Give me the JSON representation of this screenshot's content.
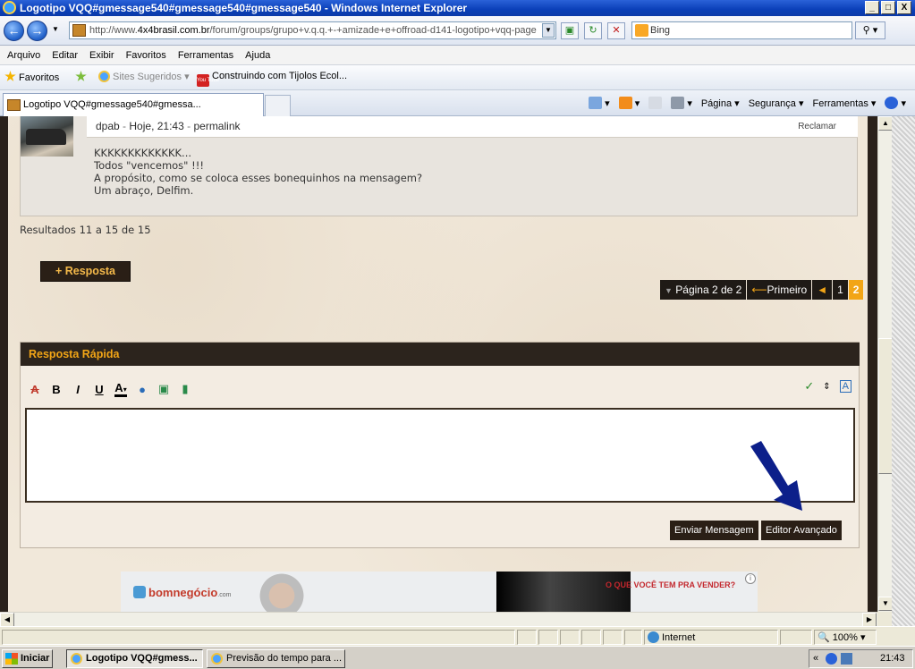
{
  "window": {
    "title": "Logotipo VQQ#gmessage540#gmessage540#gmessage540 - Windows Internet Explorer",
    "controls": [
      "_",
      "□",
      "X"
    ]
  },
  "address": {
    "url_prefix": "http://www.",
    "url_domain": "4x4brasil.com.br",
    "url_path": "/forum/groups/grupo+v.q.q.+-+amizade+e+offroad-d141-logotipo+vqq-page",
    "search_placeholder": "Bing"
  },
  "menu": [
    "Arquivo",
    "Editar",
    "Exibir",
    "Favoritos",
    "Ferramentas",
    "Ajuda"
  ],
  "favorites": {
    "favoritos": "Favoritos",
    "sites_sugeridos": "Sites Sugeridos",
    "construindo": "Construindo com Tijolos Ecol...",
    "youtube_icon_text": "You Tube"
  },
  "tab": {
    "title": "Logotipo VQQ#gmessage540#gmessa..."
  },
  "commandbar": [
    "Página",
    "Segurança",
    "Ferramentas"
  ],
  "post": {
    "author": "dpab",
    "time": "Hoje, 21:43",
    "permalink": "permalink",
    "report": "Reclamar",
    "lines": [
      "KKKKKKKKKKKKK...",
      "Todos \"vencemos\" !!!",
      "A propósito, como se coloca esses bonequinhos na mensagem?",
      "Um abraço, Delfim."
    ]
  },
  "results": "Resultados 11 a 15 de 15",
  "reply_button": "+ Resposta",
  "pager": {
    "page_label": "Página 2 de 2",
    "first": "Primeiro",
    "prev_icon": "◄",
    "pages": [
      "1",
      "2"
    ],
    "current": "2"
  },
  "quick_reply": {
    "title": "Resposta Rápida",
    "toolbar": [
      "B",
      "I",
      "U"
    ],
    "send": "Enviar Mensagem",
    "advanced": "Editor Avançado"
  },
  "ad": {
    "logo": "bomnegócio",
    "logo_suffix": ".com",
    "slogan": "O QUE VOCÊ TEM PRA VENDER?"
  },
  "status": {
    "zone": "Internet",
    "zoom": "100%"
  },
  "taskbar": {
    "start": "Iniciar",
    "tasks": [
      "Logotipo VQQ#gmess...",
      "Previsão do tempo para ..."
    ],
    "clock": "21:43"
  },
  "colors": {
    "accent_orange": "#f2a516",
    "dark_brown": "#2a1f16",
    "arrow_blue": "#0c1f8a"
  }
}
